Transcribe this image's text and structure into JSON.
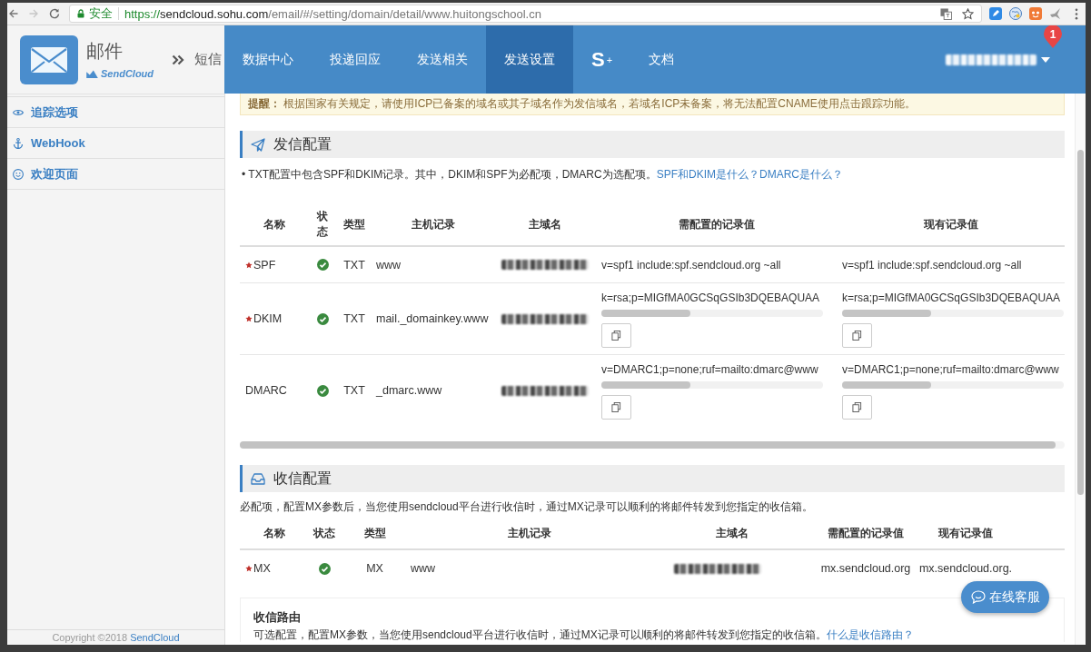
{
  "browser": {
    "secure_label": "安全",
    "url": {
      "scheme": "https://",
      "host": "sendcloud.sohu.com",
      "path": "/email/#/setting/domain/detail/www.huitongschool.cn"
    }
  },
  "header": {
    "product": "邮件",
    "brand": "SendCloud",
    "switch_label": "短信",
    "nav": [
      {
        "label": "数据中心",
        "kind": "text",
        "selected": false
      },
      {
        "label": "投递回应",
        "kind": "text",
        "selected": false
      },
      {
        "label": "发送相关",
        "kind": "text",
        "selected": false
      },
      {
        "label": "发送设置",
        "kind": "text",
        "selected": true
      },
      {
        "label": "S$^{+}$",
        "kind": "logo",
        "selected": false
      },
      {
        "label": "文档",
        "kind": "text",
        "selected": false
      }
    ],
    "account": {
      "badge": "1"
    }
  },
  "sidebar": {
    "items": [
      {
        "label": "追踪选项",
        "selected": false
      },
      {
        "label": "WebHook",
        "selected": false
      },
      {
        "label": "欢迎页面",
        "selected": false
      }
    ],
    "footer": {
      "text": "Copyright ©2018",
      "link": "SendCloud"
    }
  },
  "notice": {
    "text": "**提醒：** 根据国家有关规定，请使用ICP已备案的域名或其子域名作为发信域名，若域名ICP未备案，将无法配置CNAME使用点击跟踪功能。"
  },
  "send_config": {
    "title": "发信配置",
    "note": "• TXT配置中包含SPF和DKIM记录。其中，DKIM和SPF为必配项，DMARC为选配项。",
    "links": [
      "SPF和DKIM是什么？",
      "DMARC是什么？"
    ],
    "table": {
      "columns": [
        "名称",
        "状态",
        "类型",
        "主机记录",
        "主域名",
        "需配置的记录值",
        "现有记录值"
      ],
      "rows": [
        {
          "name": "SPF",
          "required": true,
          "verified": true,
          "type": "TXT",
          "host": "www",
          "values": [
            {
              "kind": "plain",
              "text": "v=spf1 include:spf.sendcloud.org ~all"
            },
            {
              "kind": "plain",
              "text": "v=spf1 include:spf.sendcloud.org ~all"
            }
          ]
        },
        {
          "name": "DKIM",
          "required": true,
          "verified": true,
          "type": "TXT",
          "host": "mail._domainkey.www",
          "values": [
            {
              "kind": "scroll",
              "text": "k=rsa;p=MIGfMA0GCSqGSIb3DQEBAQUAA"
            },
            {
              "kind": "scroll",
              "text": "k=rsa;p=MIGfMA0GCSqGSIb3DQEBAQUAA"
            }
          ]
        },
        {
          "name": "DMARC",
          "required": false,
          "verified": true,
          "type": "TXT",
          "host": "_dmarc.www",
          "values": [
            {
              "kind": "scroll",
              "text": "v=DMARC1;p=none;ruf=mailto:dmarc@www"
            },
            {
              "kind": "scroll",
              "text": "v=DMARC1;p=none;ruf=mailto:dmarc@www"
            }
          ]
        }
      ]
    }
  },
  "receive_config": {
    "title": "收信配置",
    "note": "必配项，配置MX参数后，当您使用sendcloud平台进行收信时，通过MX记录可以顺利的将邮件转发到您指定的收信箱。",
    "table": {
      "columns": [
        "名称",
        "状态",
        "类型",
        "主机记录",
        "主域名",
        "需配置的记录值",
        "现有记录值"
      ],
      "rows": [
        {
          "name": "MX",
          "required": true,
          "verified": true,
          "type": "MX",
          "host": "www",
          "values": [
            {
              "kind": "plain",
              "text": "mx.sendcloud.org"
            },
            {
              "kind": "plain",
              "text": "mx.sendcloud.org."
            }
          ]
        }
      ]
    }
  },
  "routing": {
    "title": "收信路由",
    "text": "可选配置，配置MX参数，当您使用sendcloud平台进行收信时，通过MX记录可以顺利的将邮件转发到您指定的收信箱。",
    "link": "什么是收信路由？"
  },
  "chat": {
    "label": "在线客服"
  }
}
